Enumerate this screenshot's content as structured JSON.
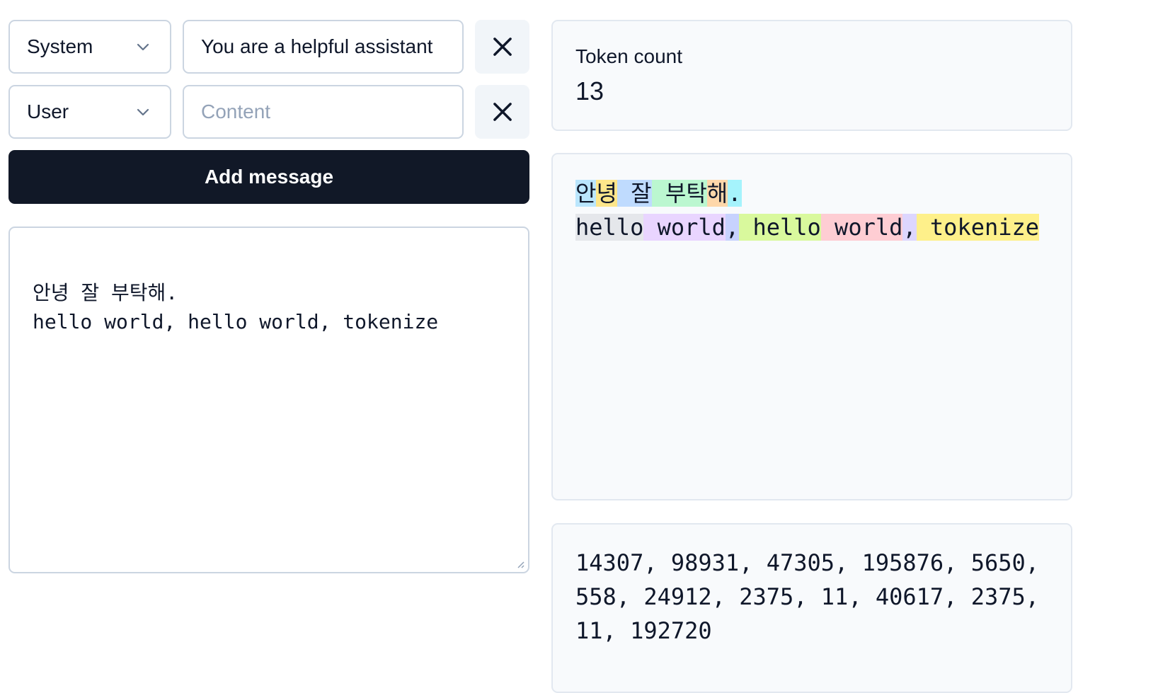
{
  "messages": [
    {
      "role": "System",
      "content": "You are a helpful assistant",
      "content_placeholder": "Content"
    },
    {
      "role": "User",
      "content": "",
      "content_placeholder": "Content"
    }
  ],
  "add_message_label": "Add message",
  "editor": {
    "lines": [
      "안녕 잘 부탁해.",
      "hello world, hello world, tokenize"
    ]
  },
  "token_count": {
    "label": "Token count",
    "value": "13"
  },
  "token_lines": [
    [
      {
        "text": "안",
        "color": "#bae6fd"
      },
      {
        "text": "녕",
        "color": "#fde68a"
      },
      {
        "text": " 잘",
        "color": "#bfdbfe"
      },
      {
        "text": " 부탁",
        "color": "#bbf7d0"
      },
      {
        "text": "해",
        "color": "#fed7aa"
      },
      {
        "text": ".",
        "color": "#a5f3fc"
      }
    ],
    [
      {
        "text": "hello",
        "color": "#e5e7eb"
      },
      {
        "text": " world",
        "color": "#e9d5ff"
      },
      {
        "text": ",",
        "color": "#c7d2fe"
      },
      {
        "text": " hello",
        "color": "#d9f99d"
      },
      {
        "text": " world",
        "color": "#fecdd3"
      },
      {
        "text": ",",
        "color": "#ddd6fe"
      },
      {
        "text": " tokenize",
        "color": "#fef08a"
      }
    ]
  ],
  "token_ids": "14307, 98931, 47305, 195876, 5650, 558, 24912, 2375, 11, 40617, 2375, 11, 192720"
}
